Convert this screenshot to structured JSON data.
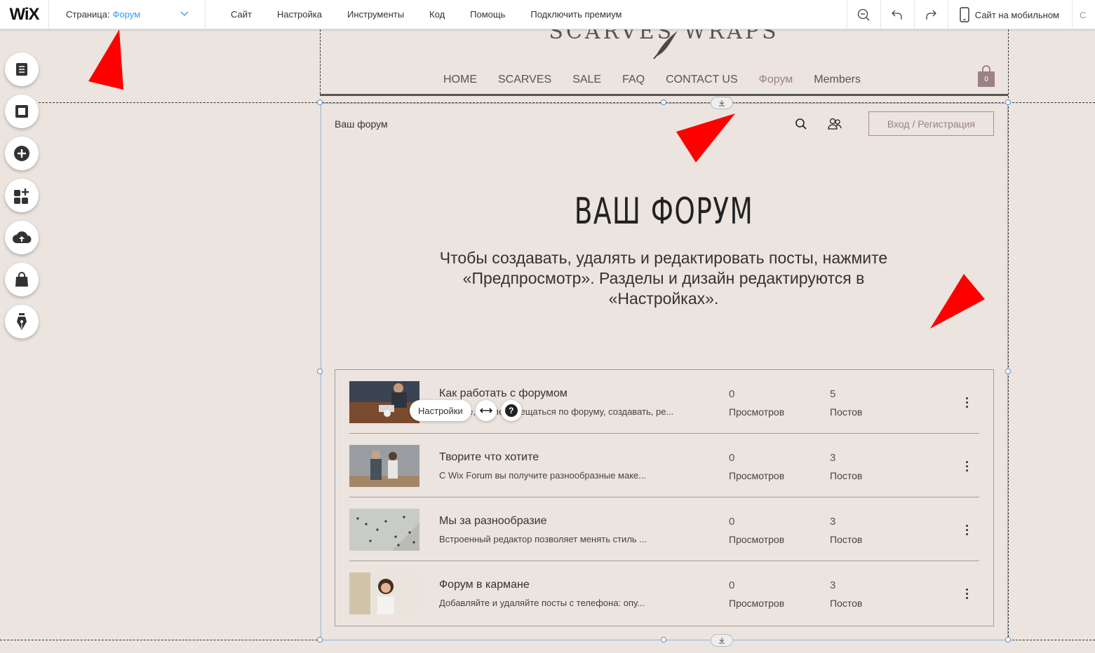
{
  "editor": {
    "logo": "WiX",
    "page_label": "Страница:",
    "page_value": "Форум",
    "menu": [
      "Сайт",
      "Настройка",
      "Инструменты",
      "Код",
      "Помощь",
      "Подключить премиум"
    ],
    "mobile_label": "Сайт на мобильном",
    "extra_label": "С",
    "tools": [
      "pages-icon",
      "background-icon",
      "add-icon",
      "app-market-icon",
      "upload-icon",
      "store-icon",
      "blog-pen-icon"
    ]
  },
  "site": {
    "logo_text": "SCARVES  WRAPS",
    "nav": [
      "HOME",
      "SCARVES",
      "SALE",
      "FAQ",
      "CONTACT US",
      "Форум",
      "Members"
    ],
    "nav_active": "Форум",
    "cart_count": "0"
  },
  "forum": {
    "bar_title": "Ваш форум",
    "login_label": "Вход / Регистрация",
    "title": "ВАШ ФОРУМ",
    "description": "Чтобы создавать, удалять и редактировать посты, нажмите «Предпросмотр». Разделы и дизайн редактируются в «Настройках».",
    "categories": [
      {
        "title": "Как работать с форумом",
        "desc": "Узнайте, как перемещаться по форуму, создавать, ре...",
        "views": "0",
        "views_label": "Просмотров",
        "posts": "5",
        "posts_label": "Постов"
      },
      {
        "title": "Творите что хотите",
        "desc": "С Wix Forum вы получите разнообразные маке...",
        "views": "0",
        "views_label": "Просмотров",
        "posts": "3",
        "posts_label": "Постов"
      },
      {
        "title": "Мы за разнообразие",
        "desc": "Встроенный редактор позволяет менять стиль ...",
        "views": "0",
        "views_label": "Просмотров",
        "posts": "3",
        "posts_label": "Постов"
      },
      {
        "title": "Форум в кармане",
        "desc": "Добавляйте и удаляйте посты с телефона: опу...",
        "views": "0",
        "views_label": "Просмотров",
        "posts": "3",
        "posts_label": "Постов"
      }
    ],
    "settings_label": "Настройки",
    "help_label": "?"
  },
  "colors": {
    "accent_blue": "#3899ec",
    "annotation_red": "#ff0000",
    "site_accent": "#9c8287",
    "background": "#ebe4df"
  }
}
